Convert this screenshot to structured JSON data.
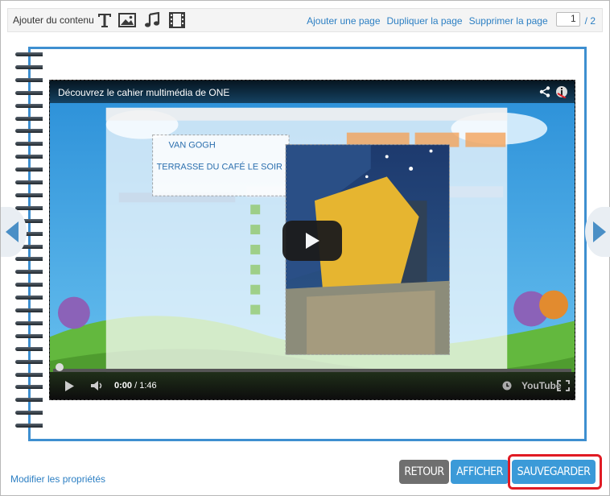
{
  "toolbar": {
    "add_content_label": "Ajouter du contenu",
    "icons": [
      "text-icon",
      "image-icon",
      "music-icon",
      "video-icon"
    ],
    "add_page": "Ajouter une page",
    "duplicate_page": "Dupliquer la page",
    "delete_page": "Supprimer la page",
    "current_page": "1",
    "total_pages": "/ 2"
  },
  "video": {
    "title": "Découvrez le cahier multimédia de ONE",
    "time": "0:00",
    "duration": "/ 1:46",
    "brand": "YouTube",
    "progress": 0
  },
  "footer": {
    "modify_properties": "Modifier les propriétés",
    "retour": "RETOUR",
    "afficher": "AFFICHER",
    "sauvegarder": "SAUVEGARDER"
  },
  "colors": {
    "accent": "#3b9ad8",
    "link": "#2c7fc3",
    "notebook_border": "#3e8fd0",
    "highlight": "#e01b24",
    "retour_bg": "#6f6f6f"
  }
}
